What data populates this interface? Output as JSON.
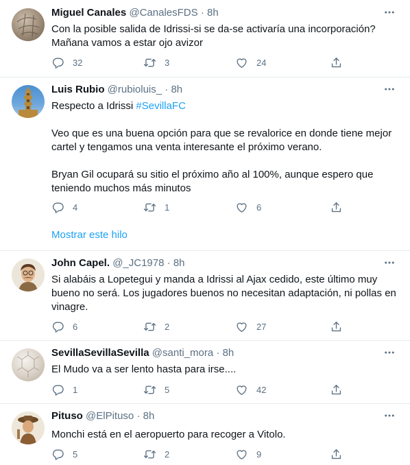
{
  "tweets": [
    {
      "name": "Miguel Canales",
      "handle": "@CanalesFDS",
      "dot": "·",
      "time": "8h",
      "lines": [
        "Con la posible salida de Idrissi-si se da-se activaría una incorporación?",
        "Mañana vamos a estar ojo avizor"
      ],
      "replies": "32",
      "retweets": "3",
      "likes": "24"
    },
    {
      "name": "Luis Rubio",
      "handle": "@rubioluis_",
      "dot": "·",
      "time": "8h",
      "first_line_text": "Respecto a Idrissi ",
      "hashtag": "#SevillaFC",
      "para2": [
        "Veo que es una buena opción para que se revalorice en donde tiene mejor",
        "cartel y tengamos una venta interesante el próximo verano."
      ],
      "para3": [
        "Bryan Gil ocupará su sitio el próximo año al 100%, aunque espero que",
        "teniendo muchos más minutos"
      ],
      "replies": "4",
      "retweets": "1",
      "likes": "6",
      "show_thread": "Mostrar este hilo"
    },
    {
      "name": "John Capel.",
      "handle": "@_JC1978",
      "dot": "·",
      "time": "8h",
      "lines": [
        "Si alabáis a Lopetegui y manda a Idrissi al Ajax cedido, este último muy",
        "bueno no será. Los jugadores buenos no necesitan adaptación, ni pollas en",
        "vinagre."
      ],
      "replies": "6",
      "retweets": "2",
      "likes": "27"
    },
    {
      "name": "SevillaSevillaSevilla",
      "handle": "@santi_mora",
      "dot": "·",
      "time": "8h",
      "lines": [
        "El Mudo va a ser lento hasta para irse...."
      ],
      "replies": "1",
      "retweets": "5",
      "likes": "42"
    },
    {
      "name": "Pituso",
      "handle": "@ElPituso",
      "dot": "·",
      "time": "8h",
      "lines": [
        "Monchi está en el aeropuerto para recoger a Vitolo."
      ],
      "replies": "5",
      "retweets": "2",
      "likes": "9"
    }
  ],
  "colors": {
    "text": "#0f1419",
    "secondary": "#5b7083",
    "accent": "#1da1f2",
    "divider": "#e6ecf0"
  },
  "icons": [
    "more-icon",
    "reply-icon",
    "retweet-icon",
    "like-icon",
    "share-icon"
  ]
}
